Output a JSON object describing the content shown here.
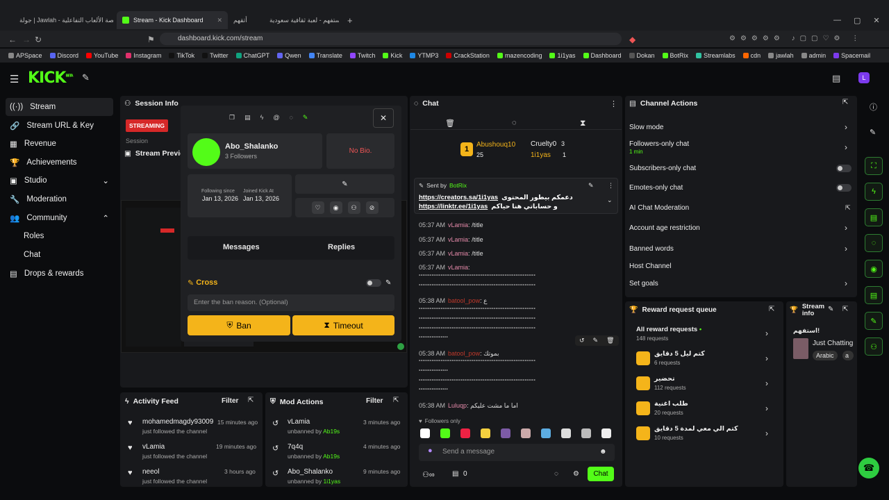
{
  "browser": {
    "tabs": [
      {
        "label": "جولة | Jawlah - منصة الألعاب التفاعلية"
      },
      {
        "label": "Stream - Kick Dashboard"
      },
      {
        "label": "أتقهم"
      },
      {
        "label": "استفهم - لعبة ثقافية سعودية"
      }
    ],
    "url": "dashboard.kick.com/stream",
    "bookmarks": [
      "APSpace",
      "Discord",
      "YouTube",
      "Instagram",
      "TikTok",
      "Twitter",
      "ChatGPT",
      "Qwen",
      "Translate",
      "Twitch",
      "Kick",
      "YTMP3",
      "CrackStation",
      "mazencoding",
      "1i1yas",
      "Dashboard",
      "Dokan",
      "BotRix",
      "Streamlabs",
      "cdn",
      "jawlah",
      "admin",
      "Spacemail"
    ]
  },
  "app": {
    "logo": "KICK",
    "logo_badge": "BETA"
  },
  "sidebar": {
    "items": [
      {
        "label": "Stream"
      },
      {
        "label": "Stream URL & Key"
      },
      {
        "label": "Revenue"
      },
      {
        "label": "Achievements"
      },
      {
        "label": "Studio"
      },
      {
        "label": "Moderation"
      },
      {
        "label": "Community"
      },
      {
        "label": "Roles"
      },
      {
        "label": "Chat"
      },
      {
        "label": "Drops & rewards"
      }
    ]
  },
  "session": {
    "title": "Session Info",
    "status": "STREAMING",
    "session_label": "Session",
    "preview_title": "Stream Preview"
  },
  "user_card": {
    "username": "Abo_Shalanko",
    "followers": "3 Followers",
    "bio": "No Bio.",
    "following_since_label": "Following since",
    "following_since": "Jan 13, 2026",
    "joined_label": "Joined Kick At",
    "joined": "Jan 13, 2026",
    "tab_messages": "Messages",
    "tab_replies": "Replies",
    "cross_label": "Cross",
    "ban_reason_placeholder": "Enter the ban reason. (Optional)",
    "ban": "Ban",
    "timeout": "Timeout"
  },
  "chat": {
    "title": "Chat",
    "leaders": [
      {
        "name": "Abushouq10",
        "count": "25"
      },
      {
        "name": "Cruelty0",
        "count": "3"
      },
      {
        "name": "1i1yas",
        "count": "1"
      }
    ],
    "pinned": {
      "sent_by_label": "Sent by",
      "sender": "BotRix",
      "text1": "https://creators.sa/1i1yas",
      "text1_ar": "دعمكم بيطور المحتوى",
      "text2": "https://linktr.ee/1i1yas",
      "text2_ar": "و حساباتي هنا حياكم"
    },
    "messages": [
      {
        "time": "05:37 AM",
        "user": "vLamia",
        "text": "/title"
      },
      {
        "time": "05:37 AM",
        "user": "vLamia",
        "text": "/title"
      },
      {
        "time": "05:37 AM",
        "user": "vLamia",
        "text": "/title"
      },
      {
        "time": "05:37 AM",
        "user": "vLamia",
        "text": ""
      },
      {
        "time": "05:38 AM",
        "user": "batool_pow",
        "text": "ع"
      },
      {
        "time": "05:38 AM",
        "user": "batool_pow",
        "text": "بموتك"
      },
      {
        "time": "05:38 AM",
        "user": "Luluqp",
        "text": "اما ما مشت عليكم"
      }
    ],
    "spam_line": "ٴٴٴٴٴٴٴٴٴٴٴٴٴٴٴٴٴٴٴٴٴٴٴٴٴٴٴٴٴٴٴٴٴٴٴٴٴٴٴٴٴٴٴٴٴٴٴٴٴٴٴٴٴٴٴٴٴٴٴٴٴٴٴٴ",
    "spam_short": "ٴٴٴٴٴٴٴٴٴٴٴٴٴٴٴٴ",
    "followers_only": "Followers only",
    "send_placeholder": "Send a message",
    "viewers": "0",
    "chat_button": "Chat"
  },
  "channel_actions": {
    "title": "Channel Actions",
    "items": [
      {
        "label": "Slow mode"
      },
      {
        "label": "Followers-only chat",
        "sub": "1 min"
      },
      {
        "label": "Subscribers-only chat"
      },
      {
        "label": "Emotes-only chat"
      },
      {
        "label": "AI Chat Moderation"
      },
      {
        "label": "Account age restriction"
      },
      {
        "label": "Banned words"
      },
      {
        "label": "Host Channel"
      },
      {
        "label": "Set goals"
      }
    ]
  },
  "reward_queue": {
    "title": "Reward request queue",
    "all_label": "All reward requests",
    "all_count": "148 requests",
    "items": [
      {
        "name": "كتم ليل 5 دقايق",
        "count": "6 requests"
      },
      {
        "name": "تحضير",
        "count": "112 requests"
      },
      {
        "name": "طلب اغنية",
        "count": "20 requests"
      },
      {
        "name": "كتم الي معي لمدة 5 دقايق",
        "count": "10 requests"
      }
    ]
  },
  "stream_info": {
    "title": "Stream info",
    "stream_title": "استفهم!",
    "category": "Just Chatting",
    "tag": "Arabic",
    "tag2": "a"
  },
  "activity_feed": {
    "title": "Activity Feed",
    "filter": "Filter",
    "items": [
      {
        "name": "mohamedmagdy93009",
        "sub": "just followed the channel",
        "time": "15 minutes ago"
      },
      {
        "name": "vLamia",
        "sub": "just followed the channel",
        "time": "19 minutes ago"
      },
      {
        "name": "neeol",
        "sub": "just followed the channel",
        "time": "3 hours ago"
      }
    ]
  },
  "mod_actions": {
    "title": "Mod Actions",
    "filter": "Filter",
    "by_label": "unbanned by",
    "items": [
      {
        "name": "vLamia",
        "by": "Ab19s",
        "time": "3 minutes ago"
      },
      {
        "name": "7q4q",
        "by": "Ab19s",
        "time": "4 minutes ago"
      },
      {
        "name": "Abo_Shalanko",
        "by": "1i1yas",
        "time": "9 minutes ago"
      }
    ]
  }
}
